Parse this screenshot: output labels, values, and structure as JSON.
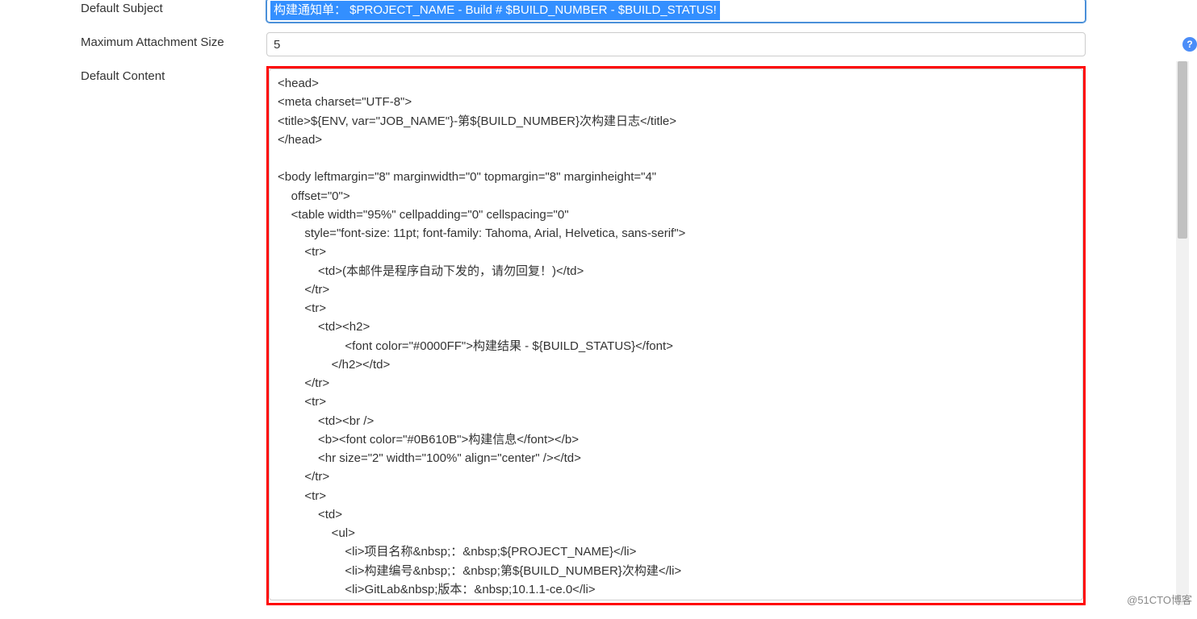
{
  "labels": {
    "default_subject": "Default Subject",
    "max_attachment": "Maximum Attachment Size",
    "default_content": "Default Content"
  },
  "fields": {
    "default_subject_value": "构建通知单： $PROJECT_NAME - Build # $BUILD_NUMBER - $BUILD_STATUS!",
    "max_attachment_value": "5",
    "default_content_value": "<head>\n<meta charset=\"UTF-8\">\n<title>${ENV, var=\"JOB_NAME\"}-第${BUILD_NUMBER}次构建日志</title>\n</head>\n\n<body leftmargin=\"8\" marginwidth=\"0\" topmargin=\"8\" marginheight=\"4\"\n    offset=\"0\">\n    <table width=\"95%\" cellpadding=\"0\" cellspacing=\"0\"\n        style=\"font-size: 11pt; font-family: Tahoma, Arial, Helvetica, sans-serif\">\n        <tr>\n            <td>(本邮件是程序自动下发的，请勿回复！)</td>\n        </tr>\n        <tr>\n            <td><h2>\n                    <font color=\"#0000FF\">构建结果 - ${BUILD_STATUS}</font>\n                </h2></td>\n        </tr>\n        <tr>\n            <td><br />\n            <b><font color=\"#0B610B\">构建信息</font></b>\n            <hr size=\"2\" width=\"100%\" align=\"center\" /></td>\n        </tr>\n        <tr>\n            <td>\n                <ul>\n                    <li>项目名称&nbsp;：&nbsp;${PROJECT_NAME}</li>\n                    <li>构建编号&nbsp;：&nbsp;第${BUILD_NUMBER}次构建</li>\n                    <li>GitLab&nbsp;版本：&nbsp;10.1.1-ce.0</li>\n                    <li>触发原因：&nbsp;${CAUSE}</li>"
  },
  "help_tooltip": "?",
  "watermark": "@51CTO博客"
}
